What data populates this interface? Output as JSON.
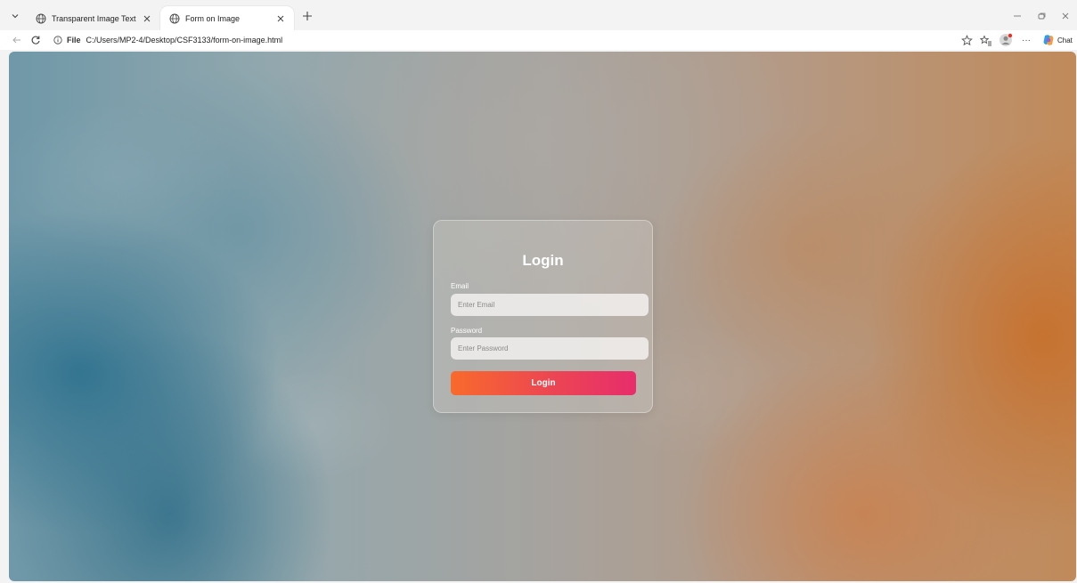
{
  "browser": {
    "tabs": [
      {
        "title": "Transparent Image Text",
        "active": false
      },
      {
        "title": "Form on Image",
        "active": true
      }
    ],
    "address": {
      "scheme": "File",
      "url": "C:/Users/MP2-4/Desktop/CSF3133/form-on-image.html"
    },
    "chat_label": "Chat",
    "more_label": "···"
  },
  "page": {
    "background_colors": {
      "left": "#2e7591",
      "right": "#c7782f",
      "center": "#a8a5a1"
    },
    "login": {
      "heading": "Login",
      "email_label": "Email",
      "email_placeholder": "Enter Email",
      "password_label": "Password",
      "password_placeholder": "Enter Password",
      "button_label": "Login",
      "button_gradient": [
        "#f96a2c",
        "#e72d6c"
      ]
    }
  }
}
